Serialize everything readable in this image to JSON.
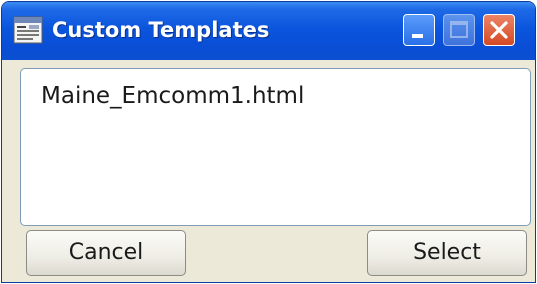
{
  "window": {
    "title": "Custom Templates",
    "icon": "template-window-icon",
    "controls": {
      "minimize": "minimize-icon",
      "maximize": "maximize-icon",
      "close": "close-icon"
    }
  },
  "list": {
    "items": [
      "Maine_Emcomm1.html"
    ]
  },
  "buttons": {
    "cancel_label": "Cancel",
    "select_label": "Select"
  },
  "colors": {
    "titlebar": "#0b55de",
    "close_button": "#d44a24",
    "dialog_background": "#ece9d8"
  }
}
